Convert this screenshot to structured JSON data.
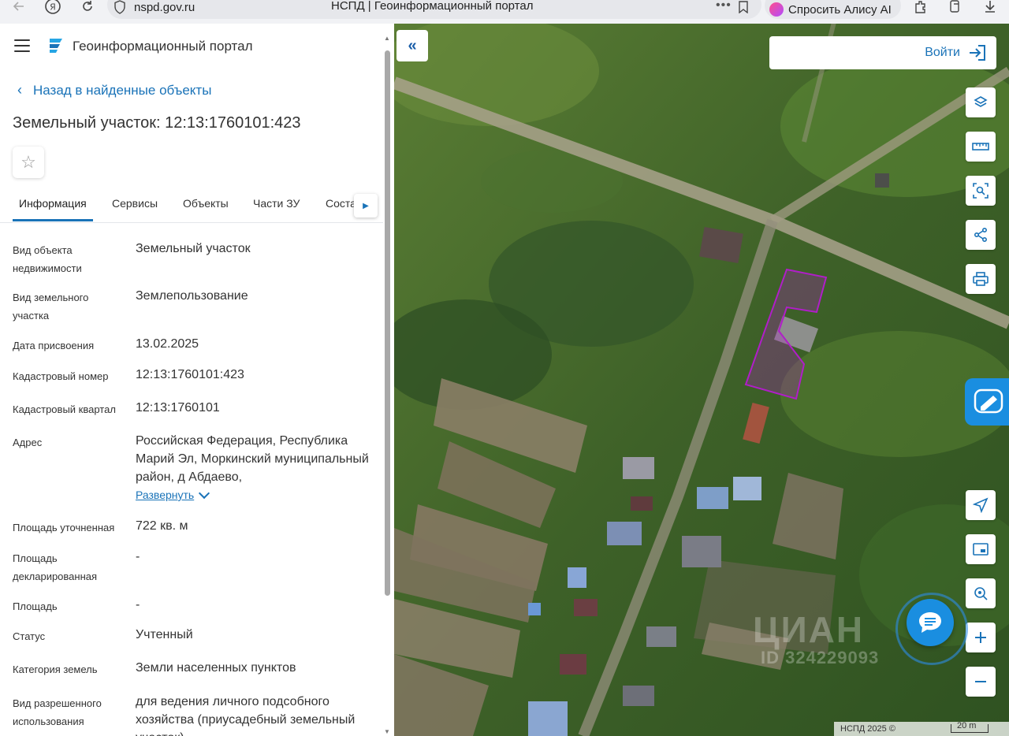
{
  "browser": {
    "url": "nspd.gov.ru",
    "tab_title": "НСПД | Геоинформационный портал",
    "alice_label": "Спросить Алису AI",
    "yandex_icon": "Я"
  },
  "panel": {
    "portal_title": "Геоинформационный портал",
    "back_link": "Назад в найденные объекты",
    "object_title": "Земельный участок: 12:13:1760101:423",
    "tabs": [
      {
        "label": "Информация"
      },
      {
        "label": "Сервисы"
      },
      {
        "label": "Объекты"
      },
      {
        "label": "Части ЗУ"
      },
      {
        "label": "Соста"
      }
    ],
    "active_tab": "Информация",
    "properties": [
      {
        "label": "Вид объекта недвижимости",
        "value": "Земельный участок"
      },
      {
        "label": "Вид земельного участка",
        "value": "Землепользование"
      },
      {
        "label": "Дата присвоения",
        "value": "13.02.2025"
      },
      {
        "label": "Кадастровый номер",
        "value": "12:13:1760101:423"
      },
      {
        "label": "Кадастровый квартал",
        "value": "12:13:1760101"
      },
      {
        "label": "Адрес",
        "value": "Российская Федерация, Республика Марий Эл, Моркинский муниципальный район, д Абдаево,"
      },
      {
        "label": "Площадь уточненная",
        "value": "722 кв. м"
      },
      {
        "label": "Площадь декларированная",
        "value": "-"
      },
      {
        "label": "Площадь",
        "value": "-"
      },
      {
        "label": "Статус",
        "value": "Учтенный"
      },
      {
        "label": "Категория земель",
        "value": "Земли населенных пунктов"
      },
      {
        "label": "Вид разрешенного использования",
        "value": "для ведения личного подсобного хозяйства (приусадебный земельный участок)"
      }
    ],
    "expand_link": "Развернуть"
  },
  "map": {
    "login_label": "Войти",
    "watermark": "ЦИАН",
    "watermark_id": "ID 324229093",
    "copyright": "НСПД 2025 ©",
    "scale_label": "20 m",
    "parcel_color": "#b01ec8",
    "accent_color": "#1a8ee0",
    "tools": [
      "layers-icon",
      "ruler-icon",
      "select-area-icon",
      "share-icon",
      "print-icon"
    ],
    "nav_tools": [
      "locate-icon",
      "minimap-icon",
      "search-location-icon",
      "zoom-in-icon",
      "zoom-out-icon"
    ]
  }
}
